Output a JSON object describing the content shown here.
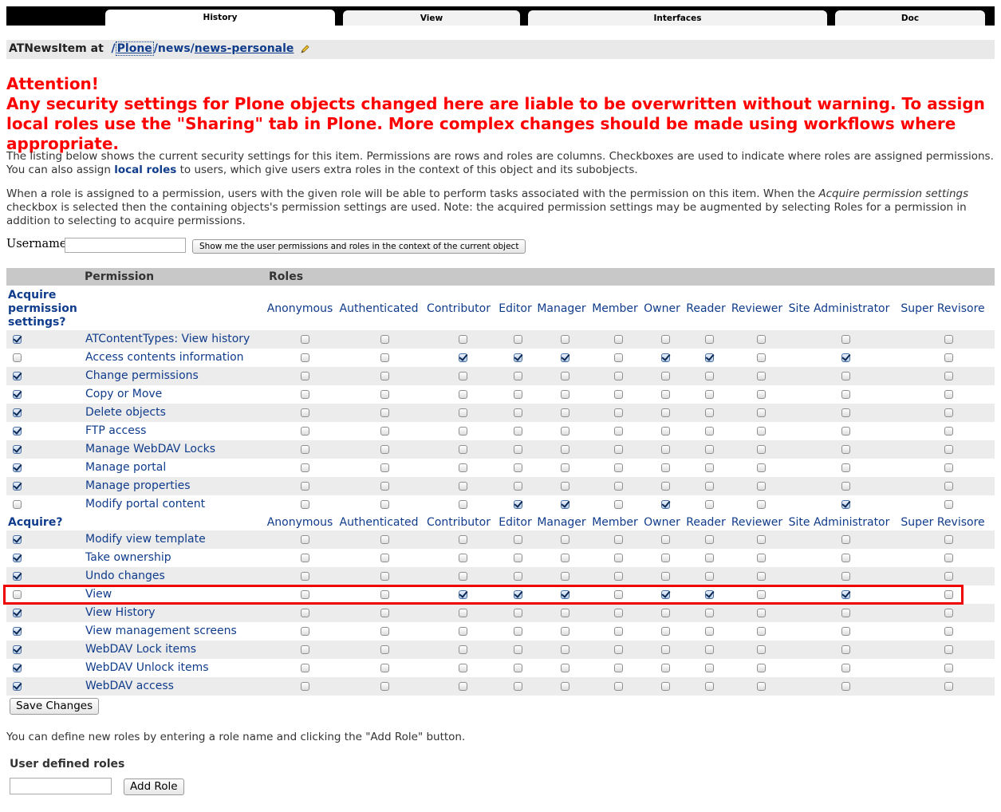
{
  "tabs": [
    "History",
    "View",
    "Interfaces",
    "Doc"
  ],
  "breadcrumb": {
    "prefix": "ATNewsItem at",
    "parts": [
      "Plone",
      "news",
      "news-personale"
    ]
  },
  "attention": {
    "title": "Attention!",
    "text": "Any security settings for Plone objects changed here are liable to be overwritten without warning. To assign local roles use the \"Sharing\" tab in Plone. More complex changes should be made using workflows where appropriate."
  },
  "intro": {
    "p1_before": "The listing below shows the current security settings for this item. Permissions are rows and roles are columns. Checkboxes are used to indicate where roles are assigned permissions. You can also assign ",
    "p1_link": "local roles",
    "p1_after": " to users, which give users extra roles in the context of this object and its subobjects.",
    "p2_before": "When a role is assigned to a permission, users with the given role will be able to perform tasks associated with the permission on this item. When the ",
    "p2_italic": "Acquire permission settings",
    "p2_after": " checkbox is selected then the containing objects's permission settings are used. Note: the acquired permission settings may be augmented by selecting Roles for a permission in addition to selecting to acquire permissions."
  },
  "user_lookup": {
    "label": "Username:",
    "value": "",
    "button": "Show me the user permissions and roles in the context of the current object"
  },
  "table": {
    "col_permission": "Permission",
    "col_roles": "Roles",
    "acquire_header_1": "Acquire permission settings?",
    "acquire_header_2": "Acquire?",
    "roles": [
      "Anonymous",
      "Authenticated",
      "Contributor",
      "Editor",
      "Manager",
      "Member",
      "Owner",
      "Reader",
      "Reviewer",
      "Site Administrator",
      "Super Revisore"
    ],
    "rows": [
      {
        "name": "ATContentTypes: View history",
        "acquire": true,
        "roles": [
          0,
          0,
          0,
          0,
          0,
          0,
          0,
          0,
          0,
          0,
          0
        ]
      },
      {
        "name": "Access contents information",
        "acquire": false,
        "roles": [
          0,
          0,
          1,
          1,
          1,
          0,
          1,
          1,
          0,
          1,
          0
        ]
      },
      {
        "name": "Change permissions",
        "acquire": true,
        "roles": [
          0,
          0,
          0,
          0,
          0,
          0,
          0,
          0,
          0,
          0,
          0
        ]
      },
      {
        "name": "Copy or Move",
        "acquire": true,
        "roles": [
          0,
          0,
          0,
          0,
          0,
          0,
          0,
          0,
          0,
          0,
          0
        ]
      },
      {
        "name": "Delete objects",
        "acquire": true,
        "roles": [
          0,
          0,
          0,
          0,
          0,
          0,
          0,
          0,
          0,
          0,
          0
        ]
      },
      {
        "name": "FTP access",
        "acquire": true,
        "roles": [
          0,
          0,
          0,
          0,
          0,
          0,
          0,
          0,
          0,
          0,
          0
        ]
      },
      {
        "name": "Manage WebDAV Locks",
        "acquire": true,
        "roles": [
          0,
          0,
          0,
          0,
          0,
          0,
          0,
          0,
          0,
          0,
          0
        ]
      },
      {
        "name": "Manage portal",
        "acquire": true,
        "roles": [
          0,
          0,
          0,
          0,
          0,
          0,
          0,
          0,
          0,
          0,
          0
        ]
      },
      {
        "name": "Manage properties",
        "acquire": true,
        "roles": [
          0,
          0,
          0,
          0,
          0,
          0,
          0,
          0,
          0,
          0,
          0
        ]
      },
      {
        "name": "Modify portal content",
        "acquire": false,
        "roles": [
          0,
          0,
          0,
          1,
          1,
          0,
          1,
          0,
          0,
          1,
          0
        ]
      },
      {
        "name": "Modify view template",
        "acquire": true,
        "roles": [
          0,
          0,
          0,
          0,
          0,
          0,
          0,
          0,
          0,
          0,
          0
        ]
      },
      {
        "name": "Take ownership",
        "acquire": true,
        "roles": [
          0,
          0,
          0,
          0,
          0,
          0,
          0,
          0,
          0,
          0,
          0
        ]
      },
      {
        "name": "Undo changes",
        "acquire": true,
        "roles": [
          0,
          0,
          0,
          0,
          0,
          0,
          0,
          0,
          0,
          0,
          0
        ]
      },
      {
        "name": "View",
        "acquire": false,
        "roles": [
          0,
          0,
          1,
          1,
          1,
          0,
          1,
          1,
          0,
          1,
          0
        ],
        "highlighted": true
      },
      {
        "name": "View History",
        "acquire": true,
        "roles": [
          0,
          0,
          0,
          0,
          0,
          0,
          0,
          0,
          0,
          0,
          0
        ]
      },
      {
        "name": "View management screens",
        "acquire": true,
        "roles": [
          0,
          0,
          0,
          0,
          0,
          0,
          0,
          0,
          0,
          0,
          0
        ]
      },
      {
        "name": "WebDAV Lock items",
        "acquire": true,
        "roles": [
          0,
          0,
          0,
          0,
          0,
          0,
          0,
          0,
          0,
          0,
          0
        ]
      },
      {
        "name": "WebDAV Unlock items",
        "acquire": true,
        "roles": [
          0,
          0,
          0,
          0,
          0,
          0,
          0,
          0,
          0,
          0,
          0
        ]
      },
      {
        "name": "WebDAV access",
        "acquire": true,
        "roles": [
          0,
          0,
          0,
          0,
          0,
          0,
          0,
          0,
          0,
          0,
          0
        ]
      }
    ]
  },
  "save_button": "Save Changes",
  "define_roles_text": "You can define new roles by entering a role name and clicking the \"Add Role\" button.",
  "user_defined_roles": {
    "label": "User defined roles",
    "value": "",
    "button": "Add Role"
  },
  "colors": {
    "attention": "#ff0000",
    "link": "#103c8c",
    "highlight": "#e00000"
  }
}
